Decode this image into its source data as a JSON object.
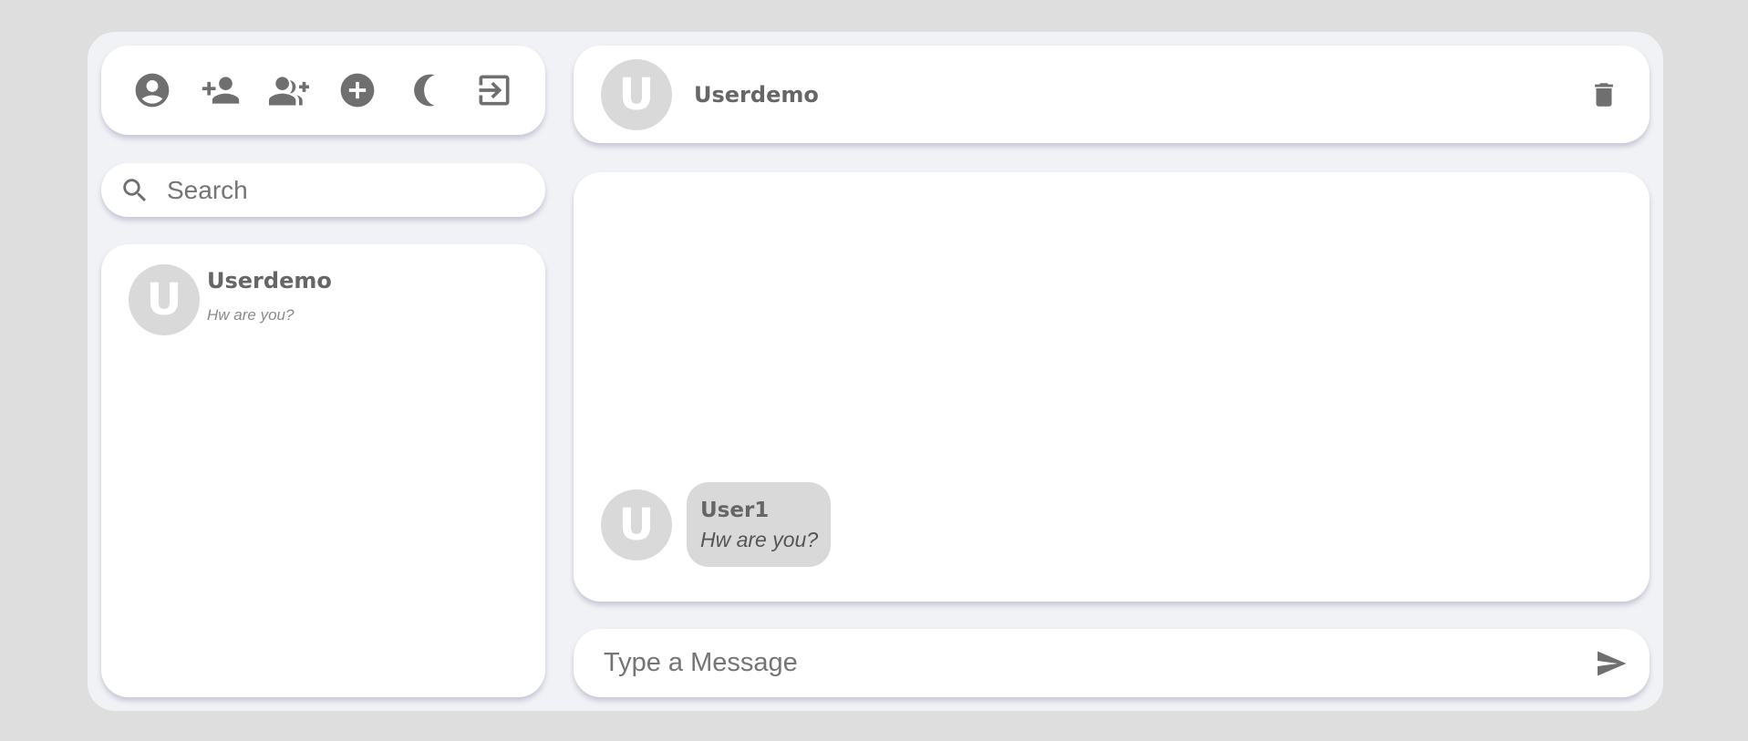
{
  "toolbar": {
    "buttons": [
      {
        "icon": "account-circle-icon"
      },
      {
        "icon": "person-add-icon"
      },
      {
        "icon": "group-add-icon"
      },
      {
        "icon": "add-circle-icon"
      },
      {
        "icon": "moon-icon"
      },
      {
        "icon": "logout-icon"
      }
    ]
  },
  "search": {
    "placeholder": "Search",
    "value": ""
  },
  "contacts": [
    {
      "initial": "U",
      "name": "Userdemo",
      "last_message": "Hw are you?"
    }
  ],
  "chat_header": {
    "initial": "U",
    "name": "Userdemo"
  },
  "messages": [
    {
      "initial": "U",
      "sender": "User1",
      "text": "Hw are you?"
    }
  ],
  "composer": {
    "placeholder": "Type a Message",
    "value": ""
  },
  "colors": {
    "page_bg": "#dedede",
    "panel_bg": "#f1f2f6",
    "card_bg": "#ffffff",
    "avatar_bg": "#d9d9d9",
    "icon": "#6f6f6f"
  }
}
